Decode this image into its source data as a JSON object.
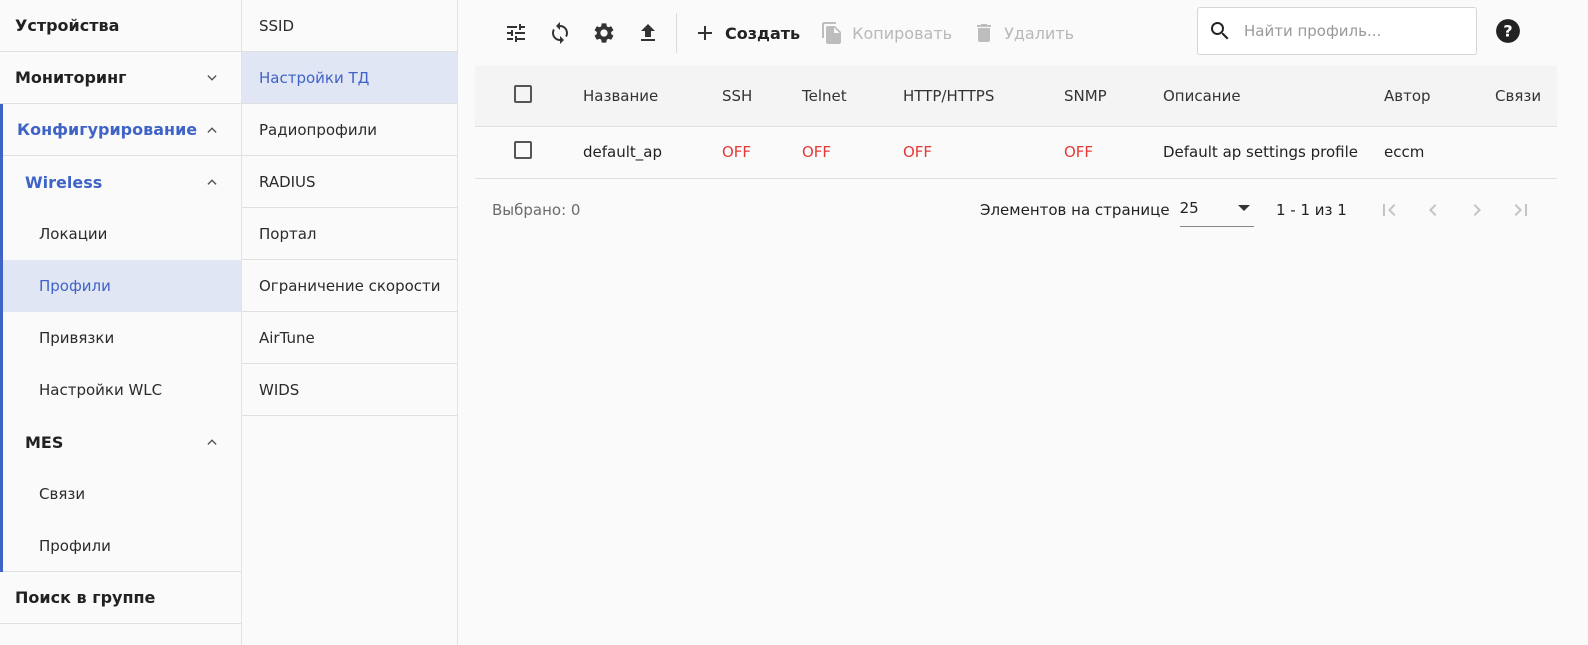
{
  "nav": {
    "devices": "Устройства",
    "monitoring": "Мониторинг",
    "configuration": "Конфигурирование",
    "wireless": "Wireless",
    "wireless_items": [
      "Локации",
      "Профили",
      "Привязки",
      "Настройки WLC"
    ],
    "mes": "MES",
    "mes_items": [
      "Связи",
      "Профили"
    ],
    "group_search": "Поиск в группе"
  },
  "sublist": [
    "SSID",
    "Настройки ТД",
    "Радиопрофили",
    "RADIUS",
    "Портал",
    "Ограничение скорости",
    "AirTune",
    "WIDS"
  ],
  "toolbar": {
    "create": "Создать",
    "copy": "Копировать",
    "delete": "Удалить",
    "search_placeholder": "Найти профиль..."
  },
  "table": {
    "headers": [
      "Название",
      "SSH",
      "Telnet",
      "HTTP/HTTPS",
      "SNMP",
      "Описание",
      "Автор",
      "Связи"
    ],
    "rows": [
      {
        "name": "default_ap",
        "ssh": "OFF",
        "telnet": "OFF",
        "http": "OFF",
        "snmp": "OFF",
        "description": "Default ap settings profile",
        "author": "eccm",
        "links": ""
      }
    ]
  },
  "pager": {
    "selected": "Выбрано: 0",
    "per_page_label": "Элементов на странице",
    "per_page_value": "25",
    "range": "1 - 1 из 1"
  },
  "colors": {
    "accent": "#3f63c7",
    "active_bg": "#e1e6f5",
    "off": "#e53935"
  }
}
